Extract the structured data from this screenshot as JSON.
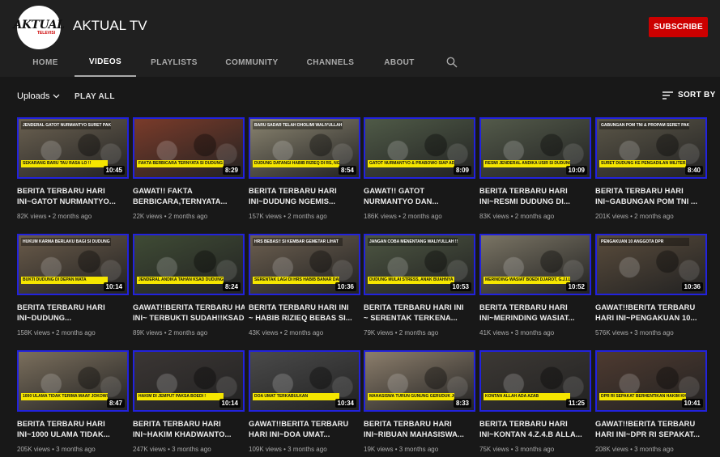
{
  "channel": {
    "name": "AKTUAL TV",
    "logo_text": "AKTUAL",
    "logo_subtext": "TELEVISI",
    "subscribe_label": "SUBSCRIBE",
    "brand_color": "#cc0000"
  },
  "tabs": [
    {
      "label": "HOME",
      "active": false
    },
    {
      "label": "VIDEOS",
      "active": true
    },
    {
      "label": "PLAYLISTS",
      "active": false
    },
    {
      "label": "COMMUNITY",
      "active": false
    },
    {
      "label": "CHANNELS",
      "active": false
    },
    {
      "label": "ABOUT",
      "active": false
    }
  ],
  "search_icon": "search-icon",
  "toolbar": {
    "uploads_label": "Uploads",
    "play_all_label": "PLAY ALL",
    "sort_by_label": "SORT BY"
  },
  "videos": [
    {
      "line1": "BERITA TERBARU HARI",
      "line2": "INI~GATOT NURMANTYO...",
      "views": "82K views",
      "age": "2 months ago",
      "duration": "10:45",
      "thumb_top": "JENDERAL GATOT NURMANTYO SURET PAKSA DUDUNG KE PENJARA GANTIKAN HABIB RIZIEQ",
      "thumb_caption": "SEKARANG BARU TAU RASA LO !!",
      "tone": "#6b6151"
    },
    {
      "line1": "GAWAT!! FAKTA",
      "line2": "BERBICARA,TERNYATA...",
      "views": "22K views",
      "age": "2 months ago",
      "duration": "8:29",
      "thumb_top": "",
      "thumb_caption": "FAKTA BERBICARA TERNYATA SI DUDUNG ANTEK KOMUNIS",
      "tone": "#7a3b2a"
    },
    {
      "line1": "BERITA TERBARU HARI",
      "line2": "INI~DUDUNG NGEMIS...",
      "views": "157K views",
      "age": "2 months ago",
      "duration": "8:54",
      "thumb_top": "BARU SADAR TELAH DHOLIMI WALIYULLAH",
      "thumb_caption": "DUDUNG DATANGI HABIB RIZIEQ DI RS, NGEMIS NGEMIS MINTA",
      "tone": "#8a8470"
    },
    {
      "line1": "GAWAT!! GATOT",
      "line2": "NURMANTYO DAN...",
      "views": "186K views",
      "age": "2 months ago",
      "duration": "8:09",
      "thumb_top": "",
      "thumb_caption": "GATOT NURMANTYO & PRABOWO SIAP ADILI DUDUNG ABDURRAHMAN",
      "tone": "#4f5a47"
    },
    {
      "line1": "BERITA TERBARU HARI",
      "line2": "INI~RESMI DUDUNG DI...",
      "views": "83K views",
      "age": "2 months ago",
      "duration": "10:09",
      "thumb_top": "",
      "thumb_caption": "RESMI JENDERAL ANDIKA USIR SI DUDUNG DARI KESATUAN",
      "tone": "#535a4a"
    },
    {
      "line1": "BERITA TERBARU HARI",
      "line2": "INI~GABUNGAN POM TNI ...",
      "views": "201K views",
      "age": "2 months ago",
      "duration": "8:40",
      "thumb_top": "GABUNGAN POM TNI & PROPAM SERET PAKSA DUDUNG ABDURRAHMAN",
      "thumb_caption": "SURET DUDUNG KE PENGADILAN MILITER, RAJA BAGI DUDUNG",
      "tone": "#5b5648"
    },
    {
      "line1": "BERITA TERBARU HARI",
      "line2": "INI~DUDUNG...",
      "views": "158K views",
      "age": "2 months ago",
      "duration": "10:14",
      "thumb_top": "HUKUM KARMA BERLAKU BAGI SI DUDUNG",
      "thumb_caption": "BUKTI DUDUNG DI DEPAN MATA",
      "tone": "#6a5b4a"
    },
    {
      "line1": "GAWAT!!BERITA TERBARU HARI",
      "line2": "INI~ TERBUKTI SUDAH!!KSAD...",
      "views": "89K views",
      "age": "2 months ago",
      "duration": "8:24",
      "thumb_top": "",
      "thumb_caption": "JENDERAL ANDIKA TAHAN KSAD DUDUNG",
      "tone": "#3f4b35"
    },
    {
      "line1": "BERITA TERBARU HARI INI",
      "line2": "~ HABIB RIZIEQ BEBAS SI...",
      "views": "43K views",
      "age": "2 months ago",
      "duration": "10:36",
      "thumb_top": "HRS BEBAS!! SI KEMBAR GEMETAR LIHAT",
      "thumb_caption": "SERENTAK LAGI DI HRS HABIB BANAR DAN WAKIT",
      "tone": "#6c5f50"
    },
    {
      "line1": "BERITA TERBARU HARI INI",
      "line2": "~ SERENTAK TERKENA...",
      "views": "79K views",
      "age": "2 months ago",
      "duration": "10:53",
      "thumb_top": "JANGAN COBA MENENTANG WALIYULLAH !!",
      "thumb_caption": "DUDUNG MULAI STRESS, ANAK BUAHNYA TIBA-TIBA",
      "tone": "#4d5642"
    },
    {
      "line1": "BERITA TERBARU HARI",
      "line2": "INI~MERINDING WASIAT...",
      "views": "41K views",
      "age": "3 months ago",
      "duration": "10:52",
      "thumb_top": "",
      "thumb_caption": "MERINDING WASIAT BOEDI DJAROT, G.J.I.L TAUBAT MASSAL",
      "tone": "#7a7464"
    },
    {
      "line1": "GAWAT!!BERITA TERBARU",
      "line2": "HARI INI~PENGAKUAN 10...",
      "views": "576K views",
      "age": "3 months ago",
      "duration": "10:36",
      "thumb_top": "PENGAKUAN 10 ANGGOTA DPR",
      "thumb_caption": "",
      "tone": "#5a4c3c"
    },
    {
      "line1": "BERITA TERBARU HARI",
      "line2": "INI~1000 ULAMA TIDAK...",
      "views": "205K views",
      "age": "3 months ago",
      "duration": "8:47",
      "thumb_top": "",
      "thumb_caption": "1000 ULAMA TIDAK TERIMA MAAF JOKOWI UNTUK HABIB RIZIEQ",
      "tone": "#7b6f5d"
    },
    {
      "line1": "BERITA TERBARU HARI",
      "line2": "INI~HAKIM KHADWANTO...",
      "views": "247K views",
      "age": "3 months ago",
      "duration": "10:14",
      "thumb_top": "",
      "thumb_caption": "HAKIM DI JEMPUT PAKSA BOEDI !",
      "tone": "#3b3634"
    },
    {
      "line1": "GAWAT!!BERITA TERBARU",
      "line2": "HARI INI~DOA UMAT...",
      "views": "109K views",
      "age": "3 months ago",
      "duration": "10:34",
      "thumb_top": "",
      "thumb_caption": "DOA UMAT TERKABULKAN",
      "tone": "#4a4a4a"
    },
    {
      "line1": "BERITA TERBARU HARI",
      "line2": "INI~RIBUAN MAHASISWA...",
      "views": "19K views",
      "age": "3 months ago",
      "duration": "8:33",
      "thumb_top": "",
      "thumb_caption": "MAHASISWA TURUN GUNUNG GERUDUK JOKOWI",
      "tone": "#8c7e6c"
    },
    {
      "line1": "BERITA TERBARU HARI",
      "line2": "INI~KONTAN 4.Z.4.B ALLA...",
      "views": "75K views",
      "age": "3 months ago",
      "duration": "11:25",
      "thumb_top": "",
      "thumb_caption": "KONTAN ALLAH ADA AZAB",
      "tone": "#3c3834"
    },
    {
      "line1": "GAWAT!!BERITA TERBARU",
      "line2": "HARI INI~DPR RI SEPAKAT...",
      "views": "208K views",
      "age": "3 months ago",
      "duration": "10:41",
      "thumb_top": "",
      "thumb_caption": "DPR RI SEPAKAT BERHENTIKAN HAKIM KHADWANTO DARI JABATANNYA",
      "tone": "#4e3a30"
    }
  ]
}
